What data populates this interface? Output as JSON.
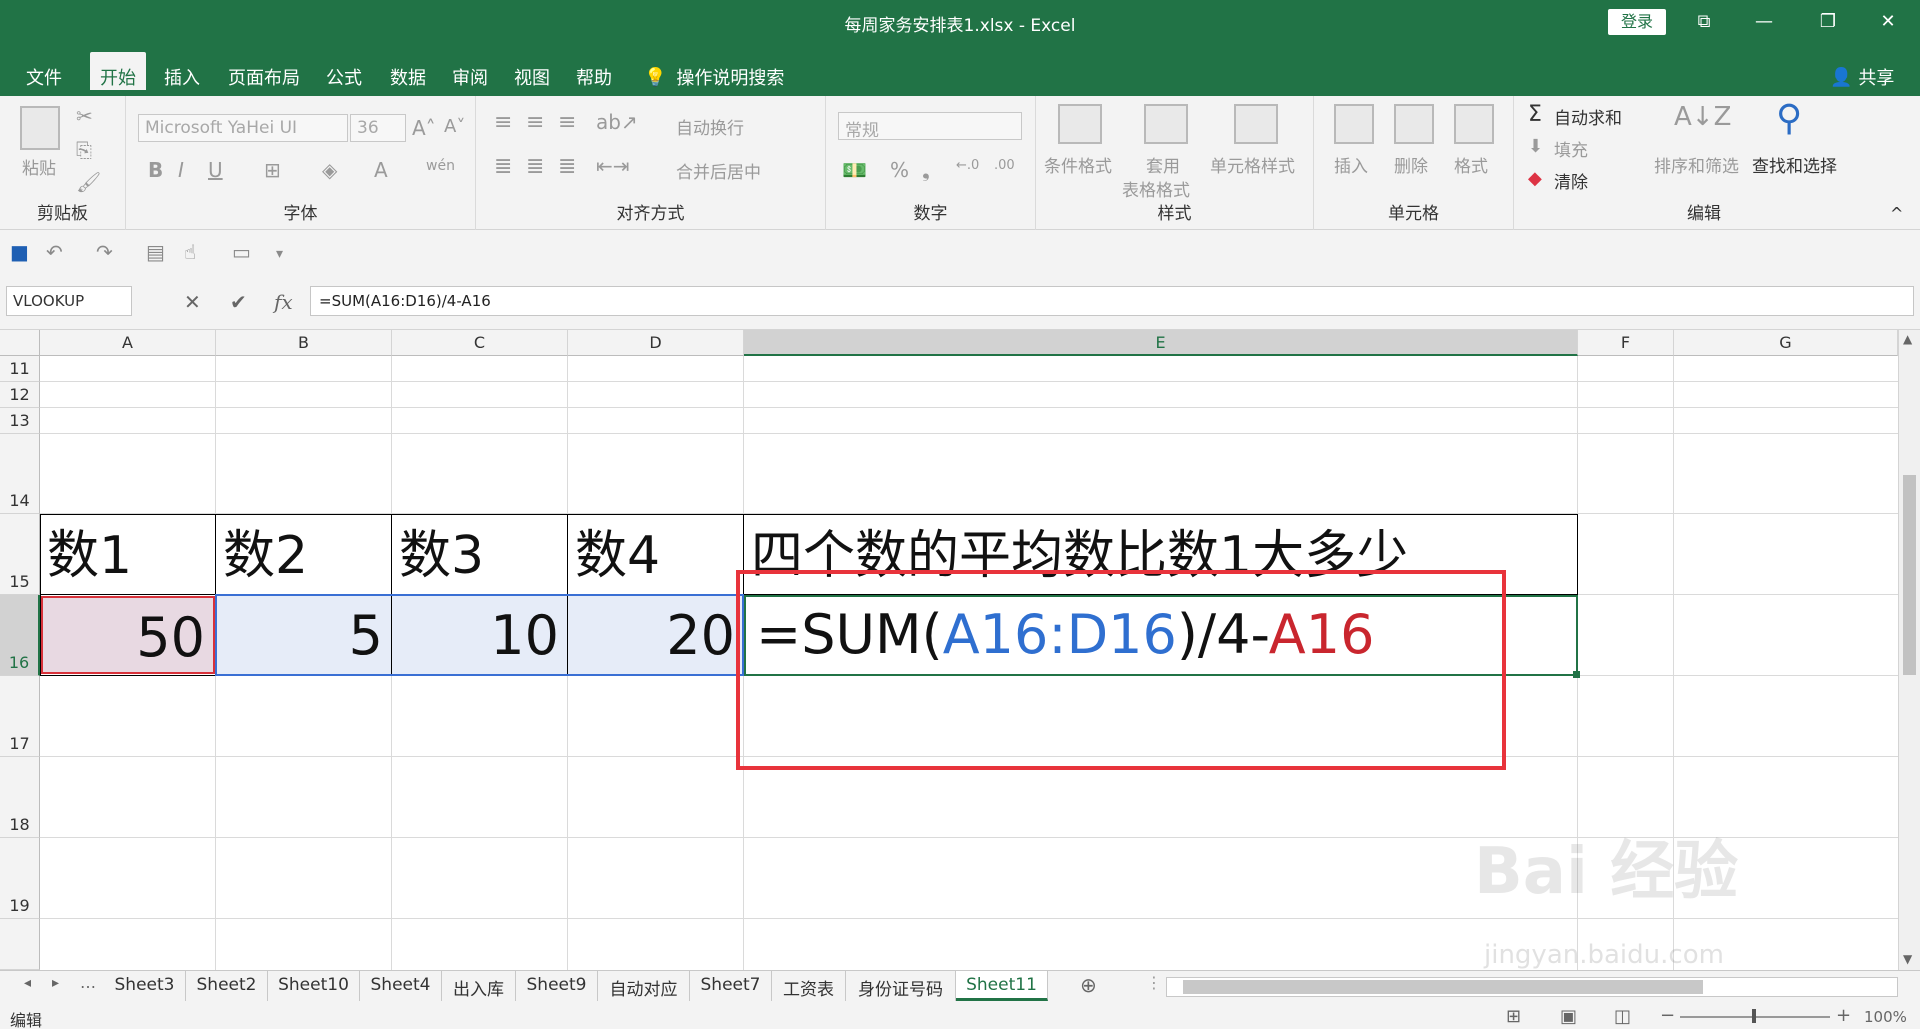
{
  "window": {
    "title": "每周家务安排表1.xlsx  -  Excel",
    "login_label": "登录",
    "controls": [
      "⧉",
      "—",
      "❐",
      "✕"
    ]
  },
  "ribbon_tabs": [
    "文件",
    "开始",
    "插入",
    "页面布局",
    "公式",
    "数据",
    "审阅",
    "视图",
    "帮助"
  ],
  "active_tab": "开始",
  "search_label": "操作说明搜索",
  "share_label": "共享",
  "ribbon": {
    "clipboard": {
      "label": "剪贴板",
      "paste": "粘贴"
    },
    "font": {
      "label": "字体",
      "name": "Microsoft YaHei UI",
      "size": "36",
      "bold": "B",
      "italic": "I",
      "underline": "U"
    },
    "alignment": {
      "label": "对齐方式",
      "wrap": "自动换行",
      "merge": "合并后居中"
    },
    "number": {
      "label": "数字",
      "format": "常规",
      "percent": "%",
      "comma": "❟"
    },
    "styles": {
      "label": "样式",
      "conditional": "条件格式",
      "table_1": "套用",
      "table_2": "表格格式",
      "cell_styles": "单元格样式"
    },
    "cells": {
      "label": "单元格",
      "insert": "插入",
      "delete": "删除",
      "format": "格式"
    },
    "editing": {
      "label": "编辑",
      "autosum": "自动求和",
      "fill": "填充",
      "clear": "清除",
      "sort": "排序和筛选",
      "find": "查找和选择"
    }
  },
  "formula_bar": {
    "name_box": "VLOOKUP",
    "cancel": "✕",
    "enter": "✔",
    "fx": "fx",
    "formula": "=SUM(A16:D16)/4-A16"
  },
  "columns": [
    "A",
    "B",
    "C",
    "D",
    "E",
    "F",
    "G"
  ],
  "rows": [
    "11",
    "12",
    "13",
    "14",
    "15",
    "16",
    "17",
    "18",
    "19"
  ],
  "cells": {
    "A15": "数1",
    "B15": "数2",
    "C15": "数3",
    "D15": "数4",
    "E15": "四个数的平均数比数1大多少",
    "A16": "50",
    "B16": "5",
    "C16": "10",
    "D16": "20",
    "E16_prefix": "=SUM(",
    "E16_ref1": "A16:D16",
    "E16_mid": ")/4-",
    "E16_ref2": "A16"
  },
  "sheet_tabs": [
    "Sheet3",
    "Sheet2",
    "Sheet10",
    "Sheet4",
    "出入库",
    "Sheet9",
    "自动对应",
    "Sheet7",
    "工资表",
    "身份证号码",
    "Sheet11"
  ],
  "active_sheet": "Sheet11",
  "status": {
    "mode": "编辑",
    "zoom": "100%"
  },
  "watermark": {
    "main": "Bai 经验",
    "sub": "jingyan.baidu.com"
  },
  "colors": {
    "excel_green": "#217346",
    "ref_blue": "#2f6fd0",
    "ref_red": "#c9262e",
    "highlight_box": "#e8333b"
  }
}
